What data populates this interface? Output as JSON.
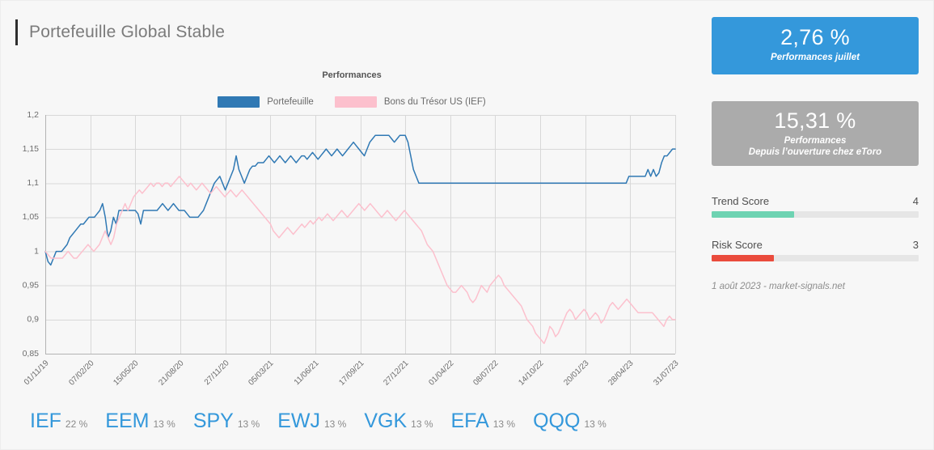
{
  "header": {
    "title": "Portefeuille Global Stable"
  },
  "chart": {
    "title": "Performances",
    "legend": [
      {
        "label": "Portefeuille",
        "color": "#3079b4"
      },
      {
        "label": "Bons du Trésor US (IEF)",
        "color": "#fcc0cd"
      }
    ]
  },
  "chart_data": {
    "type": "line",
    "title": "Performances",
    "xlabel": "",
    "ylabel": "",
    "ylim": [
      0.85,
      1.2
    ],
    "yticks": [
      "0,85",
      "0,9",
      "0,95",
      "1",
      "1,05",
      "1,1",
      "1,15",
      "1,2"
    ],
    "ytick_values": [
      0.85,
      0.9,
      0.95,
      1.0,
      1.05,
      1.1,
      1.15,
      1.2
    ],
    "grid": true,
    "legend_position": "top-center",
    "categories": [
      "01/11/19",
      "07/02/20",
      "15/05/20",
      "21/08/20",
      "27/11/20",
      "05/03/21",
      "11/06/21",
      "17/09/21",
      "27/12/21",
      "01/04/22",
      "08/07/22",
      "14/10/22",
      "20/01/23",
      "28/04/23",
      "31/07/23"
    ],
    "series": [
      {
        "name": "Portefeuille",
        "color": "#3079b4",
        "values": [
          1.0,
          0.985,
          0.98,
          0.99,
          1.0,
          1.0,
          1.0,
          1.005,
          1.01,
          1.02,
          1.025,
          1.03,
          1.035,
          1.04,
          1.04,
          1.045,
          1.05,
          1.05,
          1.05,
          1.055,
          1.06,
          1.07,
          1.05,
          1.02,
          1.03,
          1.05,
          1.04,
          1.06,
          1.06,
          1.06,
          1.06,
          1.06,
          1.06,
          1.06,
          1.055,
          1.04,
          1.06,
          1.06,
          1.06,
          1.06,
          1.06,
          1.06,
          1.065,
          1.07,
          1.065,
          1.06,
          1.065,
          1.07,
          1.065,
          1.06,
          1.06,
          1.06,
          1.055,
          1.05,
          1.05,
          1.05,
          1.05,
          1.055,
          1.06,
          1.07,
          1.08,
          1.09,
          1.1,
          1.105,
          1.11,
          1.1,
          1.09,
          1.1,
          1.11,
          1.12,
          1.14,
          1.12,
          1.11,
          1.1,
          1.11,
          1.12,
          1.125,
          1.125,
          1.13,
          1.13,
          1.13,
          1.135,
          1.14,
          1.135,
          1.13,
          1.135,
          1.14,
          1.135,
          1.13,
          1.135,
          1.14,
          1.135,
          1.13,
          1.135,
          1.14,
          1.14,
          1.135,
          1.14,
          1.145,
          1.14,
          1.135,
          1.14,
          1.145,
          1.15,
          1.145,
          1.14,
          1.145,
          1.15,
          1.145,
          1.14,
          1.145,
          1.15,
          1.155,
          1.16,
          1.155,
          1.15,
          1.145,
          1.14,
          1.15,
          1.16,
          1.165,
          1.17,
          1.17,
          1.17,
          1.17,
          1.17,
          1.17,
          1.165,
          1.16,
          1.165,
          1.17,
          1.17,
          1.17,
          1.16,
          1.14,
          1.12,
          1.11,
          1.1,
          1.1,
          1.1,
          1.1,
          1.1,
          1.1,
          1.1,
          1.1,
          1.1,
          1.1,
          1.1,
          1.1,
          1.1,
          1.1,
          1.1,
          1.1,
          1.1,
          1.1,
          1.1,
          1.1,
          1.1,
          1.1,
          1.1,
          1.1,
          1.1,
          1.1,
          1.1,
          1.1,
          1.1,
          1.1,
          1.1,
          1.1,
          1.1,
          1.1,
          1.1,
          1.1,
          1.1,
          1.1,
          1.1,
          1.1,
          1.1,
          1.1,
          1.1,
          1.1,
          1.1,
          1.1,
          1.1,
          1.1,
          1.1,
          1.1,
          1.1,
          1.1,
          1.1,
          1.1,
          1.1,
          1.1,
          1.1,
          1.1,
          1.1,
          1.1,
          1.1,
          1.1,
          1.1,
          1.1,
          1.1,
          1.1,
          1.1,
          1.1,
          1.1,
          1.1,
          1.1,
          1.1,
          1.1,
          1.1,
          1.1,
          1.1,
          1.1,
          1.11,
          1.11,
          1.11,
          1.11,
          1.11,
          1.11,
          1.11,
          1.12,
          1.11,
          1.12,
          1.11,
          1.115,
          1.13,
          1.14,
          1.14,
          1.145,
          1.15,
          1.15
        ],
        "start_value": 1.0,
        "end_value": 1.15,
        "max_value": 1.17,
        "min_value": 0.98
      },
      {
        "name": "Bons du Trésor US (IEF)",
        "color": "#fcc0cd",
        "values": [
          1.0,
          0.995,
          0.99,
          0.99,
          0.99,
          0.99,
          0.99,
          0.995,
          1.0,
          0.995,
          0.99,
          0.99,
          0.995,
          1.0,
          1.005,
          1.01,
          1.005,
          1.0,
          1.005,
          1.01,
          1.02,
          1.03,
          1.02,
          1.01,
          1.02,
          1.04,
          1.05,
          1.06,
          1.07,
          1.06,
          1.07,
          1.08,
          1.085,
          1.09,
          1.085,
          1.09,
          1.095,
          1.1,
          1.095,
          1.1,
          1.1,
          1.095,
          1.1,
          1.1,
          1.095,
          1.1,
          1.105,
          1.11,
          1.105,
          1.1,
          1.095,
          1.1,
          1.095,
          1.09,
          1.095,
          1.1,
          1.095,
          1.09,
          1.085,
          1.09,
          1.095,
          1.09,
          1.085,
          1.08,
          1.085,
          1.09,
          1.085,
          1.08,
          1.085,
          1.09,
          1.085,
          1.08,
          1.075,
          1.07,
          1.065,
          1.06,
          1.055,
          1.05,
          1.045,
          1.04,
          1.03,
          1.025,
          1.02,
          1.025,
          1.03,
          1.035,
          1.03,
          1.025,
          1.03,
          1.035,
          1.04,
          1.035,
          1.04,
          1.045,
          1.04,
          1.045,
          1.05,
          1.045,
          1.05,
          1.055,
          1.05,
          1.045,
          1.05,
          1.055,
          1.06,
          1.055,
          1.05,
          1.055,
          1.06,
          1.065,
          1.07,
          1.065,
          1.06,
          1.065,
          1.07,
          1.065,
          1.06,
          1.055,
          1.05,
          1.055,
          1.06,
          1.055,
          1.05,
          1.045,
          1.05,
          1.055,
          1.06,
          1.055,
          1.05,
          1.045,
          1.04,
          1.035,
          1.03,
          1.02,
          1.01,
          1.005,
          1.0,
          0.99,
          0.98,
          0.97,
          0.96,
          0.95,
          0.945,
          0.94,
          0.94,
          0.945,
          0.95,
          0.945,
          0.94,
          0.93,
          0.925,
          0.93,
          0.94,
          0.95,
          0.945,
          0.94,
          0.95,
          0.955,
          0.96,
          0.965,
          0.96,
          0.95,
          0.945,
          0.94,
          0.935,
          0.93,
          0.925,
          0.92,
          0.91,
          0.9,
          0.895,
          0.89,
          0.88,
          0.875,
          0.87,
          0.865,
          0.875,
          0.89,
          0.885,
          0.875,
          0.88,
          0.89,
          0.9,
          0.91,
          0.915,
          0.91,
          0.9,
          0.905,
          0.91,
          0.915,
          0.91,
          0.9,
          0.905,
          0.91,
          0.905,
          0.895,
          0.9,
          0.91,
          0.92,
          0.925,
          0.92,
          0.915,
          0.92,
          0.925,
          0.93,
          0.925,
          0.92,
          0.915,
          0.91,
          0.91,
          0.91,
          0.91,
          0.91,
          0.91,
          0.905,
          0.9,
          0.895,
          0.89,
          0.9,
          0.905,
          0.9,
          0.9
        ],
        "start_value": 1.0,
        "end_value": 0.9,
        "max_value": 1.11,
        "min_value": 0.865
      }
    ]
  },
  "holdings": [
    {
      "ticker": "IEF",
      "weight": "22 %"
    },
    {
      "ticker": "EEM",
      "weight": "13 %"
    },
    {
      "ticker": "SPY",
      "weight": "13 %"
    },
    {
      "ticker": "EWJ",
      "weight": "13 %"
    },
    {
      "ticker": "VGK",
      "weight": "13 %"
    },
    {
      "ticker": "EFA",
      "weight": "13 %"
    },
    {
      "ticker": "QQQ",
      "weight": "13 %"
    }
  ],
  "kpi": {
    "month": {
      "value": "2,76 %",
      "caption": "Performances juillet",
      "color": "#3498db"
    },
    "total": {
      "value": "15,31 %",
      "caption_line1": "Performances",
      "caption_line2": "Depuis l’ouverture chez eToro",
      "color": "#ababab"
    }
  },
  "scores": [
    {
      "label": "Trend Score",
      "value": "4",
      "percent": 40,
      "color": "#6ed3b2"
    },
    {
      "label": "Risk Score",
      "value": "3",
      "percent": 30,
      "color": "#ea4b3c"
    }
  ],
  "footnote": "1 août 2023 - market-signals.net"
}
